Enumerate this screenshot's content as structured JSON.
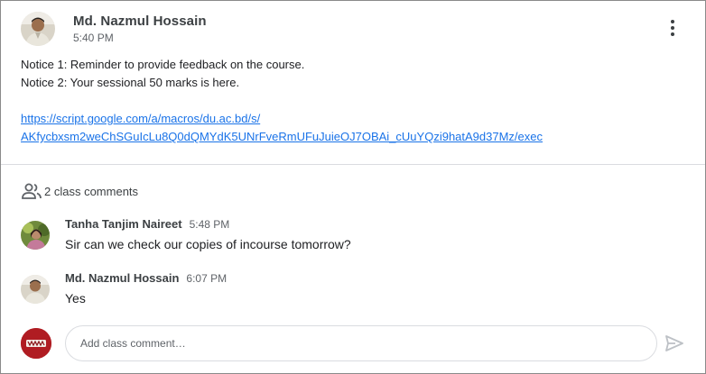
{
  "post": {
    "author": "Md. Nazmul Hossain",
    "time": "5:40 PM",
    "avatar_icon": "person-photo-avatar",
    "menu_icon": "more-vert-icon",
    "lines": [
      "Notice 1: Reminder to provide feedback on the course.",
      "Notice 2: Your sessional 50 marks is here."
    ],
    "link_line1": "https://script.google.com/a/macros/du.ac.bd/s/",
    "link_line2": "AKfycbxsm2weChSGuIcLu8Q0dQMYdK5UNrFveRmUFuJuieOJ7OBAi_cUuYQzi9hatA9d37Mz/exec"
  },
  "comments": {
    "count_label": "2 class comments",
    "icon": "people-icon",
    "items": [
      {
        "author": "Tanha Tanjim Naireet",
        "time": "5:48 PM",
        "text": "Sir can we check our copies of incourse tomorrow?"
      },
      {
        "author": "Md. Nazmul Hossain",
        "time": "6:07 PM",
        "text": "Yes"
      }
    ]
  },
  "composer": {
    "placeholder": "Add class comment…",
    "value": "",
    "send_icon": "send-icon"
  },
  "colors": {
    "link": "#1a73e8",
    "composer_avatar_bg": "#b01c22",
    "send_icon": "#bdc1c6"
  }
}
